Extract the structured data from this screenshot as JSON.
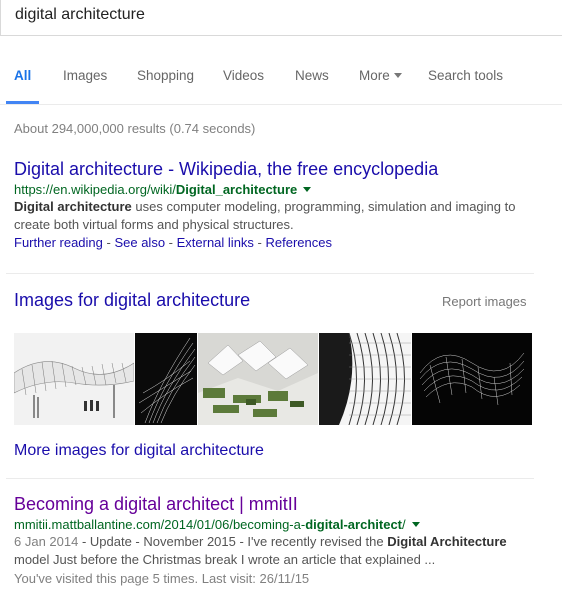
{
  "search": {
    "query": "digital architecture"
  },
  "tabs": [
    {
      "label": "All"
    },
    {
      "label": "Images"
    },
    {
      "label": "Shopping"
    },
    {
      "label": "Videos"
    },
    {
      "label": "News"
    },
    {
      "label": "More"
    },
    {
      "label": "Search tools"
    }
  ],
  "stats": "About 294,000,000 results (0.74 seconds)",
  "result1": {
    "title": "Digital architecture - Wikipedia, the free encyclopedia",
    "url_prefix": "https://en.wikipedia.org/wiki/",
    "url_bold": "Digital_architecture",
    "snippet_bold": "Digital architecture",
    "snippet_rest": " uses computer modeling, programming, simulation and imaging to create both virtual forms and physical structures.",
    "sitelinks": [
      "Further reading",
      "See also",
      "External links",
      "References"
    ],
    "sitelink_separator": " - "
  },
  "images": {
    "title": "Images for digital architecture",
    "report": "Report images",
    "more": "More images for digital architecture"
  },
  "result2": {
    "title": "Becoming a digital architect | mmitII",
    "url_prefix": "mmitii.mattballantine.com/2014/01/06/becoming-a-",
    "url_bold": "digital-architect",
    "url_suffix": "/",
    "date": "6 Jan 2014",
    "snippet_a": " - Update - November 2015 - I've recently revised the ",
    "snippet_bold": "Digital Architecture",
    "snippet_b": " model Just before the Christmas break I wrote an article that explained ...",
    "visited": "You've visited this page 5 times. Last visit: 26/11/15"
  },
  "colors": {
    "link": "#1a0dab",
    "visited_link": "#660099",
    "url_green": "#006621",
    "tab_active": "#1a73e8"
  }
}
